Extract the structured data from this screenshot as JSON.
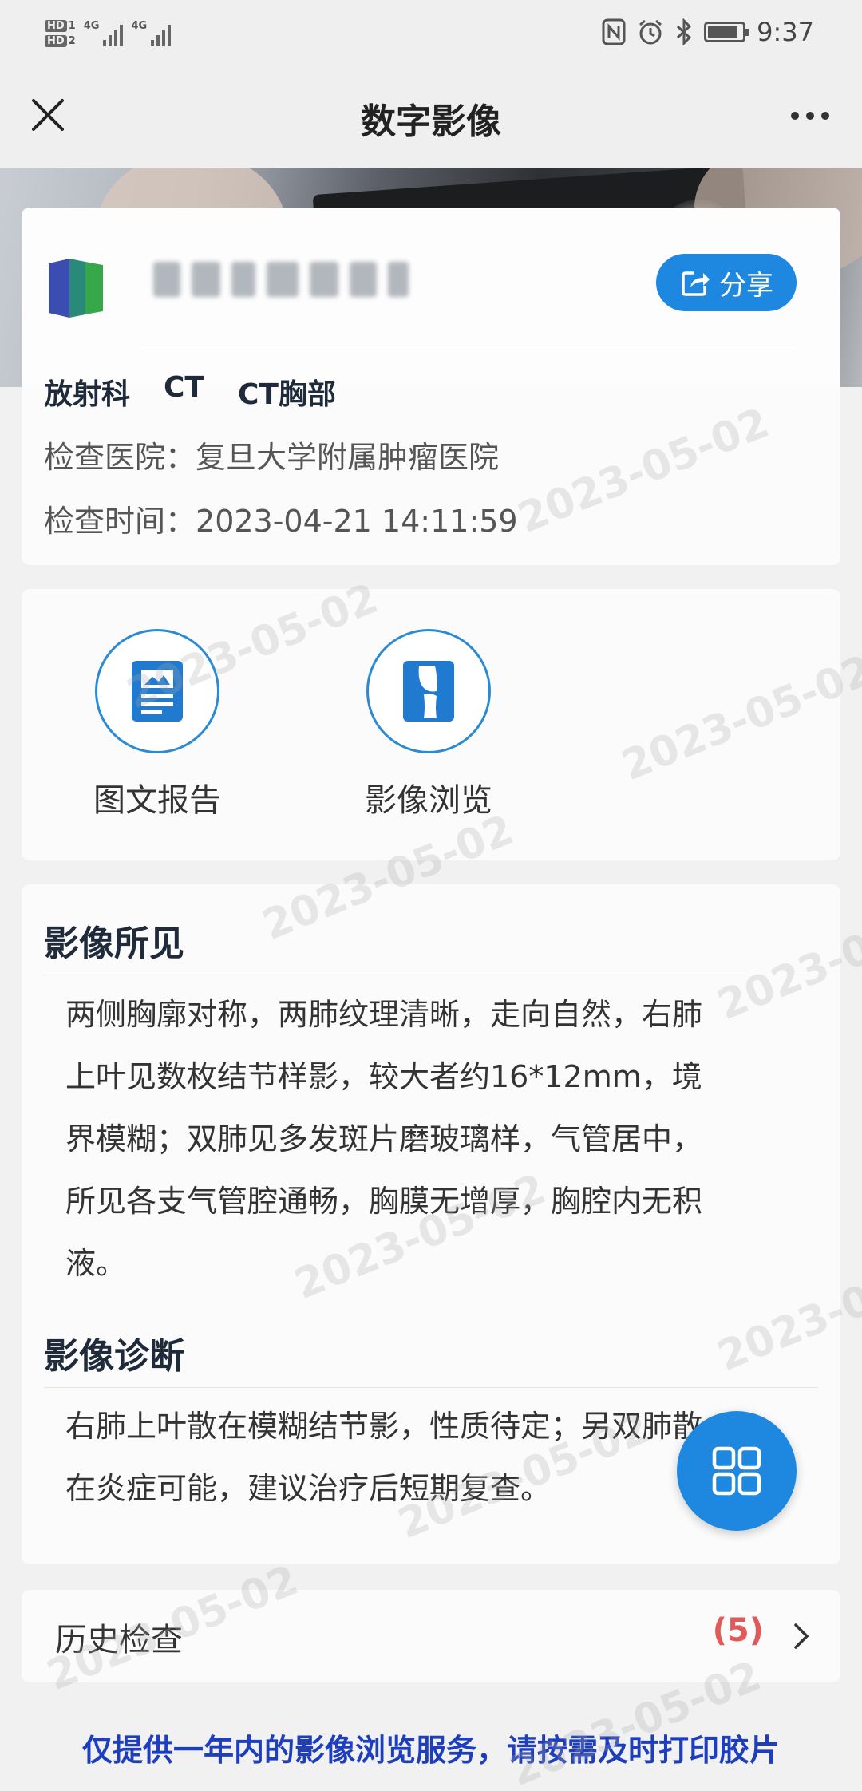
{
  "status_bar": {
    "hd1": "HD",
    "hd1_sub": "1",
    "hd2": "HD",
    "hd2_sub": "2",
    "net1": "4G",
    "net2": "4G",
    "battery_level": 0.8,
    "time": "9:37"
  },
  "nav": {
    "title": "数字影像",
    "close_icon": "close-icon",
    "more_icon": "more-dots-icon"
  },
  "record": {
    "share_label": "分享",
    "department": "放射科",
    "modality": "CT",
    "body_part": "CT胸部",
    "hospital_label": "检查医院：",
    "hospital": "复旦大学附属肿瘤医院",
    "time_label": "检查时间：",
    "time": "2023-04-21 14:11:59"
  },
  "actions": [
    {
      "label": "图文报告",
      "icon": "report-icon"
    },
    {
      "label": "影像浏览",
      "icon": "xray-icon"
    }
  ],
  "report": {
    "findings_title": "影像所见",
    "findings_lines": [
      "两侧胸廓对称，两肺纹理清晰，走向自然，右肺",
      "上叶见数枚结节样影，较大者约16*12mm，境",
      "界模糊；双肺见多发斑片磨玻璃样，气管居中，",
      "所见各支气管腔通畅，胸膜无增厚，胸腔内无积",
      "液。"
    ],
    "diagnosis_title": "影像诊断",
    "diagnosis_lines": [
      "右肺上叶散在模糊结节影，性质待定；另双肺散",
      "在炎症可能，建议治疗后短期复查。"
    ]
  },
  "history": {
    "label": "历史检查",
    "count": "(5)"
  },
  "notice": "仅提供一年内的影像浏览服务，请按需及时打印胶片",
  "watermark": "2023-05-02",
  "colors": {
    "accent": "#1e88e0",
    "notice": "#1d3ebd",
    "count": "#e05a5a"
  }
}
